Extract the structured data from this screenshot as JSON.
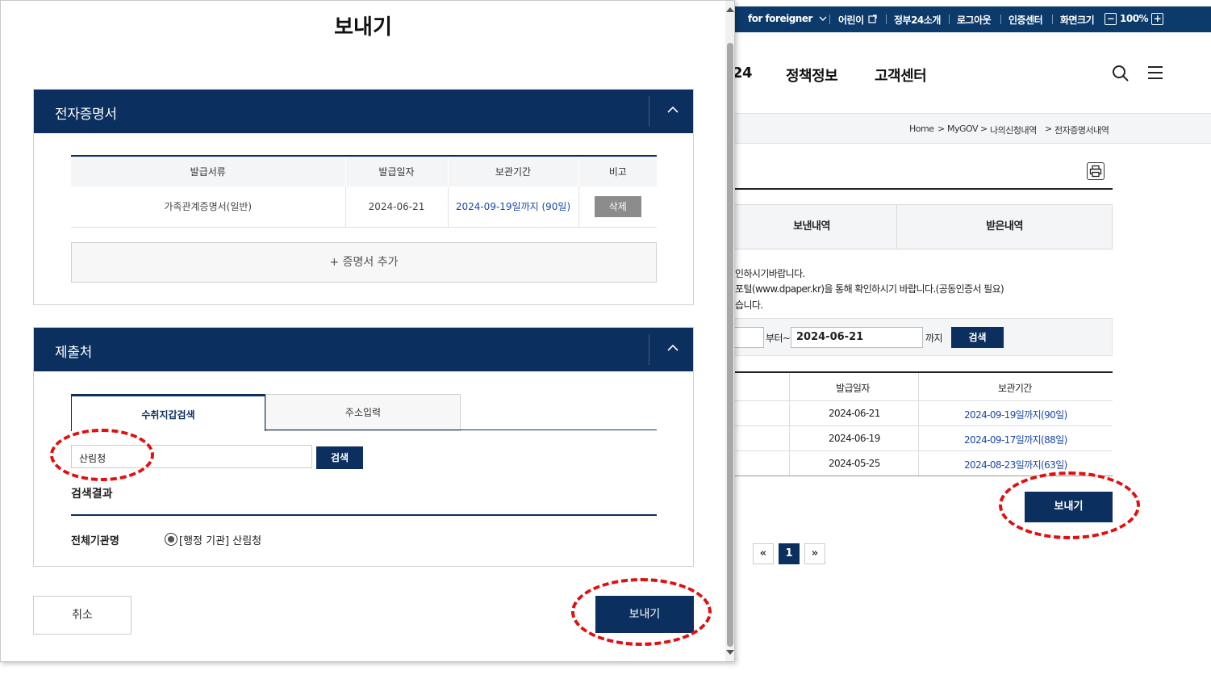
{
  "background": {
    "topbar": {
      "foreigner": "for foreigner",
      "kids": "어린이",
      "intro": "정부24소개",
      "logout": "로그아웃",
      "cert_center": "인증센터",
      "screen_size": "화면크기",
      "zoom_minus": "−",
      "zoom_level": "100%",
      "zoom_plus": "+"
    },
    "gnb": {
      "menu_partial": "24",
      "menu_policy": "정책정보",
      "menu_support": "고객센터"
    },
    "breadcrumb": [
      "Home",
      ">",
      "MyGOV",
      ">",
      "나의신청내역",
      ">",
      "전자증명서내역"
    ],
    "tabs": {
      "sent": "보낸내역",
      "received": "받은내역"
    },
    "notice": [
      "인하시기바랍니다.",
      "포털(www.dpaper.kr)을 통해 확인하시기 바랍니다.(공동인증서 필요)",
      "습니다."
    ],
    "date_filter": {
      "from_label": "부터~",
      "to_value": "2024-06-21",
      "to_label": "까지",
      "search_btn": "검색"
    },
    "history_table": {
      "headers": [
        "발급일자",
        "보관기간"
      ],
      "rows": [
        [
          "2024-06-21",
          "2024-09-19일까지(90일)"
        ],
        [
          "2024-06-19",
          "2024-09-17일까지(88일)"
        ],
        [
          "2024-05-25",
          "2024-08-23일까지(63일)"
        ]
      ]
    },
    "send_btn": "보내기",
    "pager": {
      "first": "«",
      "current": "1",
      "last": "»"
    }
  },
  "modal": {
    "title": "보내기",
    "cert_section": {
      "title": "전자증명서",
      "headers": [
        "발급서류",
        "발급일자",
        "보관기간",
        "비고"
      ],
      "row": {
        "doc": "가족관계증명서(일반)",
        "issued": "2024-06-21",
        "keep": "2024-09-19일까지 (90일)",
        "delete": "삭제"
      },
      "add": "+ 증명서 추가"
    },
    "submit_section": {
      "title": "제출처",
      "tab_search": "수취지갑검색",
      "tab_address": "주소입력",
      "search_value": "산림청",
      "search_btn": "검색",
      "results_title": "검색결과",
      "org_label": "전체기관명",
      "org_result": "[행정 기관] 산림청"
    },
    "cancel": "취소",
    "send": "보내기"
  },
  "colors": {
    "navy": "#0b2f5e",
    "highlight": "#e01010",
    "link": "#1b4aa8"
  }
}
